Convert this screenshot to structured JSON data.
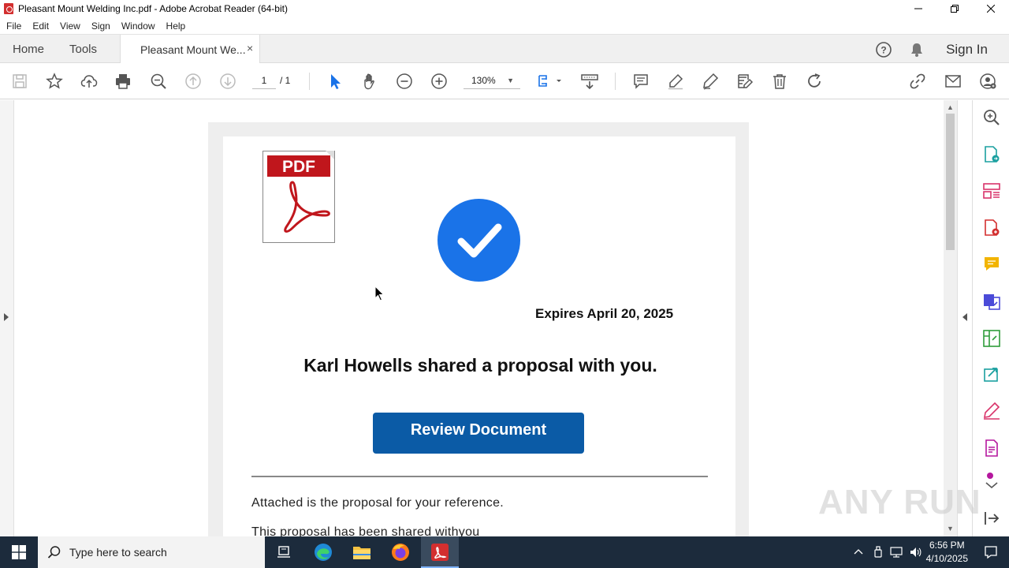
{
  "window": {
    "title": "Pleasant Mount Welding Inc.pdf - Adobe Acrobat Reader (64-bit)"
  },
  "menu": [
    "File",
    "Edit",
    "View",
    "Sign",
    "Window",
    "Help"
  ],
  "tabs": {
    "home": "Home",
    "tools": "Tools",
    "document": "Pleasant Mount We...",
    "close": "×",
    "sign_in": "Sign In"
  },
  "toolbar": {
    "page_current": "1",
    "page_total": "/ 1",
    "zoom": "130%"
  },
  "document": {
    "pdf_badge": "PDF",
    "expires": "Expires April 20, 2025",
    "heading": "Karl Howells shared a proposal with you.",
    "button": "Review Document",
    "para1": "Attached is the proposal for your reference.",
    "para2": "This proposal has been shared withyou"
  },
  "watermark": "ANY RUN",
  "taskbar": {
    "search_placeholder": "Type here to search",
    "time": "6:56 PM",
    "date": "4/10/2025"
  },
  "colors": {
    "accent_blue": "#1a73e8",
    "button_blue": "#0b5ba6",
    "adobe_red": "#d32f2f",
    "taskbar": "#1c2b3c"
  }
}
